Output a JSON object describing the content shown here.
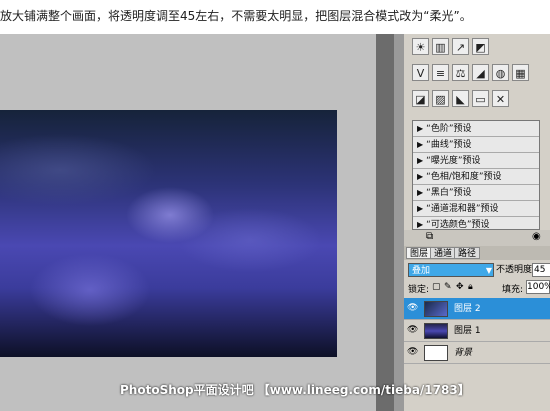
{
  "caption": {
    "text": "放大铺满整个画面，将透明度调至45左右，不需要太明显，把图层混合模式改为“柔光”。"
  },
  "adjustments": {
    "row1": [
      {
        "name": "brightness-icon",
        "glyph": "☀"
      },
      {
        "name": "levels-icon",
        "glyph": "▥"
      },
      {
        "name": "curves-icon",
        "glyph": "↗"
      },
      {
        "name": "exposure-icon",
        "glyph": "◩"
      }
    ],
    "row2": [
      {
        "name": "vibrance-icon",
        "glyph": "V"
      },
      {
        "name": "hue-sat-icon",
        "glyph": "≡"
      },
      {
        "name": "color-balance-icon",
        "glyph": "⚖"
      },
      {
        "name": "bw-icon",
        "glyph": "◢"
      },
      {
        "name": "photo-filter-icon",
        "glyph": "◍"
      },
      {
        "name": "channel-mixer-icon",
        "glyph": "▦"
      }
    ],
    "row3": [
      {
        "name": "invert-icon",
        "glyph": "◪"
      },
      {
        "name": "posterize-icon",
        "glyph": "▨"
      },
      {
        "name": "threshold-icon",
        "glyph": "◣"
      },
      {
        "name": "gradient-map-icon",
        "glyph": "▭"
      },
      {
        "name": "selective-color-icon",
        "glyph": "✕"
      }
    ]
  },
  "presets": [
    "“色阶”预设",
    "“曲线”预设",
    "“曝光度”预设",
    "“色相/饱和度”预设",
    "“黑白”预设",
    "“通道混和器”预设",
    "“可选颜色”预设"
  ],
  "layers_panel": {
    "tabs": [
      "图层",
      "通道",
      "路径"
    ],
    "blend_mode": "叠加",
    "opacity_label": "不透明度:",
    "opacity_value": "45",
    "lock_label": "锁定:",
    "fill_label": "填充:",
    "fill_value": "100%",
    "layers": [
      {
        "name": "图层 2",
        "selected": true
      },
      {
        "name": "图层 1",
        "selected": false
      },
      {
        "name": "背景",
        "selected": false
      }
    ]
  },
  "watermark": "PhotoShop平面设计吧 【www.lineeg.com/tieba/1783】"
}
